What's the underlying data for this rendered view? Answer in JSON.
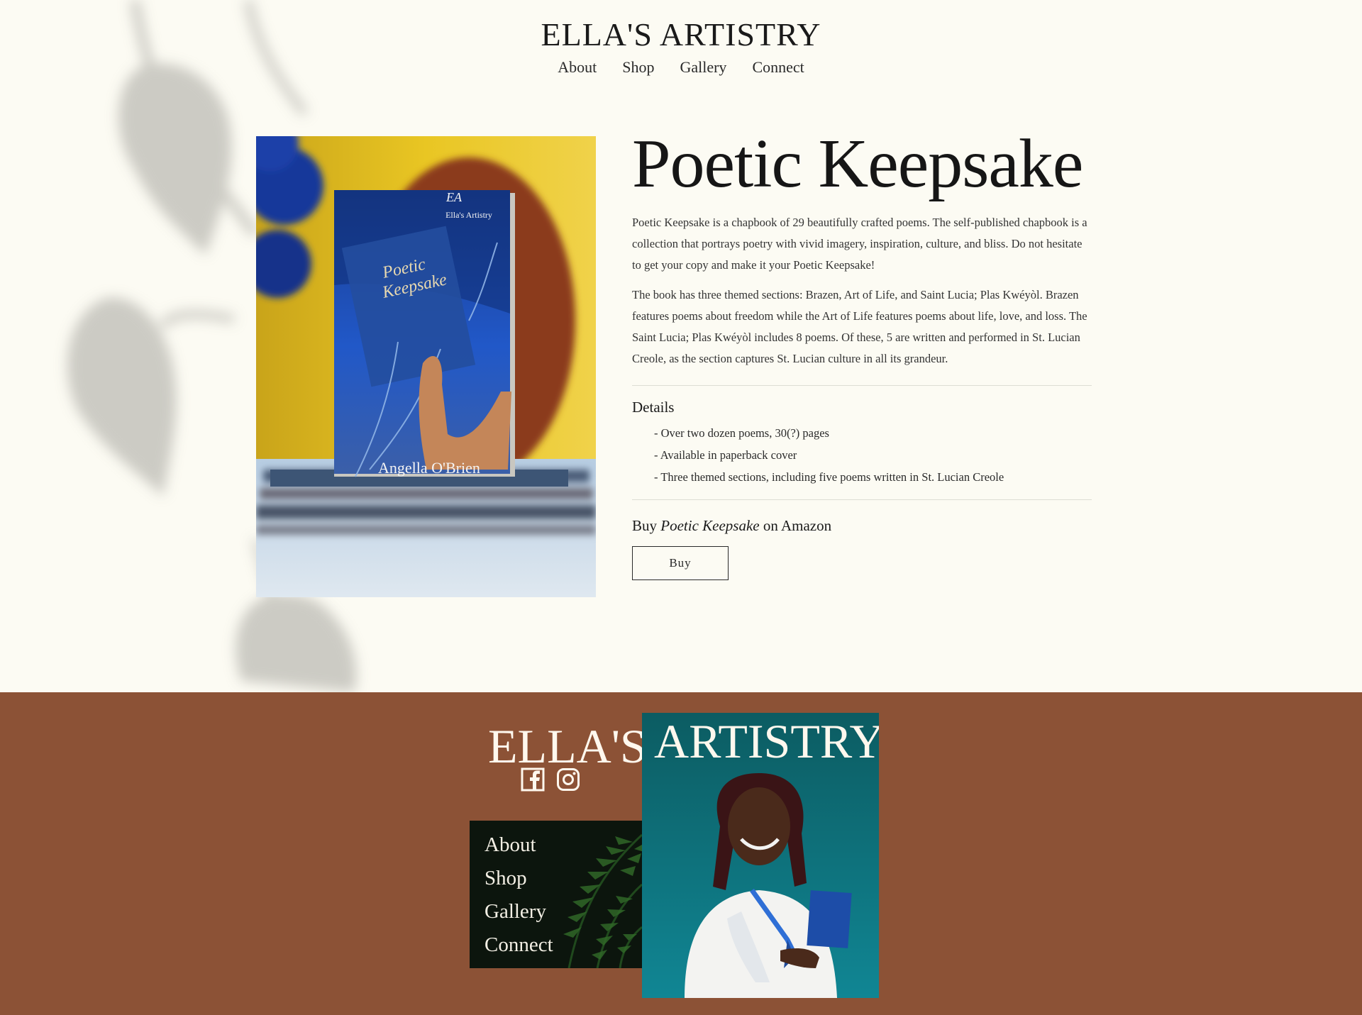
{
  "header": {
    "title": "ELLA'S ARTISTRY",
    "nav": [
      "About",
      "Shop",
      "Gallery",
      "Connect"
    ]
  },
  "product": {
    "title": "Poetic Keepsake",
    "description": [
      "Poetic Keepsake is a chapbook of 29 beautifully crafted poems. The self-published chapbook is a collection that portrays poetry with vivid imagery, inspiration, culture, and bliss. Do not hesitate to get your copy and make it your Poetic Keepsake!",
      "The book has three themed sections: Brazen, Art of Life, and Saint Lucia; Plas Kwéyòl. Brazen features poems about freedom while the Art of Life features poems about life, love, and loss. The Saint Lucia; Plas Kwéyòl includes 8 poems. Of these, 5 are written and performed in St. Lucian Creole, as the section captures St. Lucian culture in all its grandeur."
    ],
    "details_heading": "Details",
    "details": [
      "- Over two dozen poems, 30(?) pages",
      "- Available in paperback cover",
      "- Three themed sections, including five poems written in St. Lucian Creole"
    ],
    "buy_prefix": "Buy ",
    "buy_title": "Poetic Keepsake",
    "buy_suffix": " on Amazon",
    "buy_button": "Buy"
  },
  "book_cover": {
    "logo_monogram": "EA",
    "logo_text": "Ella's Artistry",
    "title_line1": "Poetic",
    "title_line2": "Keepsake",
    "author": "Angella O'Brien"
  },
  "footer": {
    "brand_left": "ELLA'S",
    "brand_right": "ARTISTRY",
    "nav": [
      "About",
      "Shop",
      "Gallery",
      "Connect"
    ],
    "social": [
      "facebook-icon",
      "instagram-icon"
    ],
    "bg_color": "#8c5236"
  }
}
